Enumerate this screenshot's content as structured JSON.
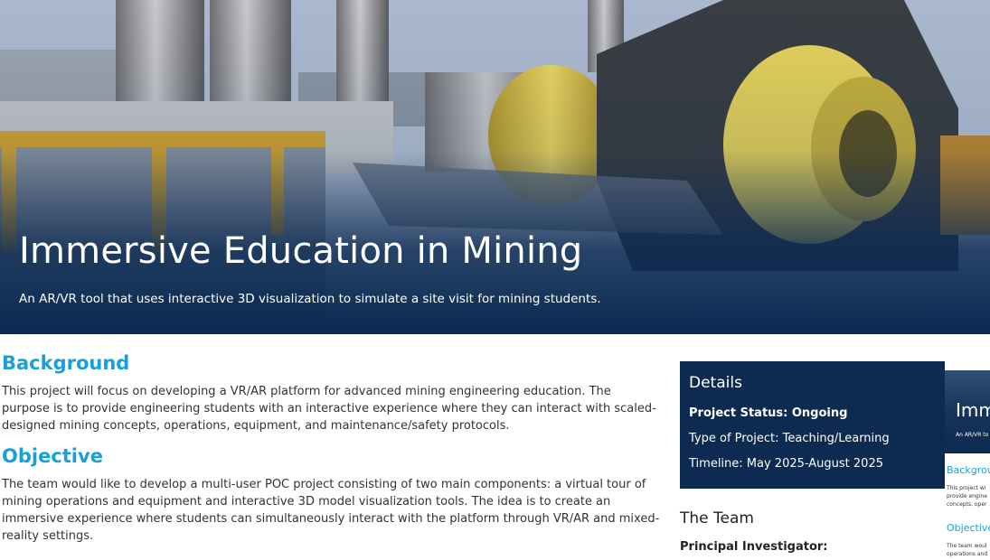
{
  "hero": {
    "title": "Immersive Education in Mining",
    "subtitle": "An AR/VR tool that uses interactive 3D visualization to simulate a site visit for mining students."
  },
  "background": {
    "heading": "Background",
    "text": "This project will focus on developing a VR/AR platform for advanced mining engineering education. The purpose is to provide engineering students with an interactive experience where they can interact with scaled-designed mining concepts, operations, equipment, and maintenance/safety protocols."
  },
  "objective": {
    "heading": "Objective",
    "text": "The team would like to develop a multi-user POC project consisting of two main components: a virtual tour of mining operations and equipment and interactive 3D model visualization tools. The idea is to create an immersive experience where students can simultaneously interact with the platform through VR/AR and mixed-reality settings."
  },
  "details": {
    "heading": "Details",
    "status": "Project Status: Ongoing",
    "type": "Type of Project: Teaching/Learning",
    "timeline": "Timeline: May 2025-August 2025"
  },
  "team": {
    "heading": "The Team",
    "pi_label": "Principal Investigator:"
  },
  "thumbnail": {
    "title": "Imm",
    "subtitle": "An AR/VR to",
    "h1": "Backgrou",
    "p1a": "This project wi",
    "p1b": "provide engine",
    "p1c": "concepts, oper",
    "h2": "Objective",
    "p2a": "The team woul",
    "p2b": "operations and"
  },
  "colors": {
    "accent": "#1aa0d8",
    "details_bg": "#0d2b50"
  }
}
